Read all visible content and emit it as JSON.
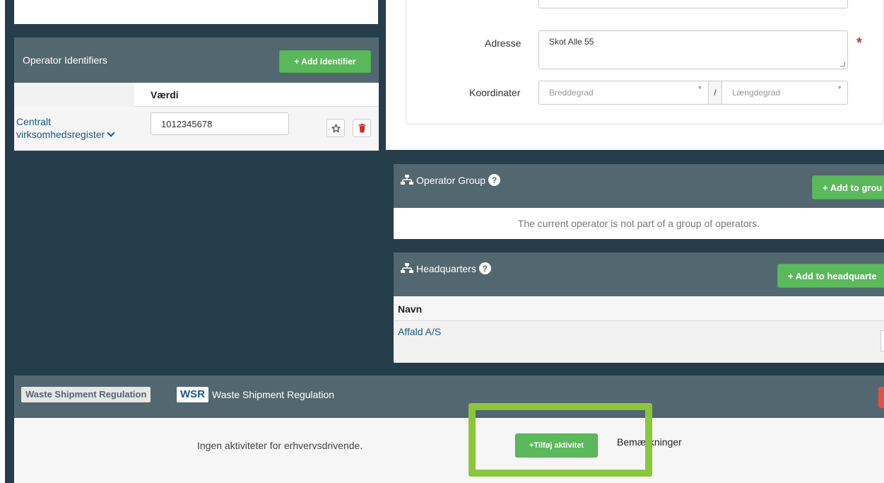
{
  "operator_identifiers": {
    "title": "Operator Identifiers",
    "add_button": "+ Add Identifier",
    "column_value": "Værdi",
    "row": {
      "scheme_line1": "Centralt",
      "scheme_line2": "virksomhedsregister",
      "value": "1012345678"
    }
  },
  "address_form": {
    "address_label": "Adresse",
    "address_value": "Skot Alle 55",
    "required_mark": "*",
    "coordinates_label": "Koordinater",
    "latitude_placeholder": "Breddegrad",
    "longitude_placeholder": "Længdegrad",
    "degree_symbol": "°",
    "separator": "/"
  },
  "operator_group": {
    "title": "Operator Group",
    "help": "?",
    "add_button": "+ Add to grou",
    "empty_text": "The current operator is not part of a group of operators."
  },
  "headquarters": {
    "title": "Headquarters",
    "help": "?",
    "add_button": "+ Add to headquarte",
    "column_name": "Navn",
    "rows": [
      {
        "name": "Affald A/S"
      }
    ]
  },
  "wsr_section": {
    "tag_label": "Waste Shipment Regulation",
    "badge": "WSR",
    "title": "Waste Shipment Regulation",
    "empty_text": "Ingen aktiviteter for erhvervsdrivende.",
    "add_button": "+Tilføj aktivitet",
    "remarks_label": "Bemærkninger"
  },
  "colors": {
    "dark_background": "#263d4b",
    "panel_header": "#536770",
    "green_button": "#5cb85c",
    "highlight": "#8cc63f",
    "link": "#1a5a8c",
    "required": "#c0392b"
  },
  "icons": {
    "star": "star-icon",
    "trash": "trash-icon",
    "sitemap": "sitemap-icon",
    "help": "help-icon",
    "chevron": "chevron-down-icon"
  }
}
